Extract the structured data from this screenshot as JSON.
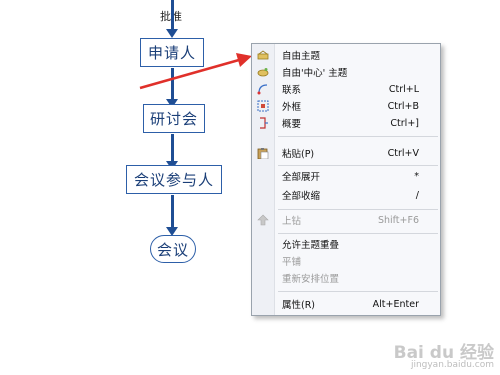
{
  "canvas": {
    "top_label": "批准",
    "nodes": {
      "n1": "申请人",
      "n2": "研讨会",
      "n3": "会议参与人",
      "n4": "会议"
    }
  },
  "colors": {
    "wire": "#1f4e94",
    "arrow": "#e0302a",
    "menu_bg": "#f7f8fb"
  },
  "menu": {
    "items": [
      {
        "label": "自由主题",
        "shortcut": "",
        "icon": "free-topic-icon"
      },
      {
        "label": "自由'中心' 主题",
        "shortcut": "",
        "icon": "free-central-topic-icon"
      },
      {
        "label": "联系",
        "shortcut": "Ctrl+L",
        "icon": "relationship-icon"
      },
      {
        "label": "外框",
        "shortcut": "Ctrl+B",
        "icon": "boundary-icon"
      },
      {
        "label": "概要",
        "shortcut": "Ctrl+]",
        "icon": "summary-icon"
      },
      {
        "label": "粘贴(P)",
        "shortcut": "Ctrl+V",
        "icon": "paste-icon"
      },
      {
        "label": "全部展开",
        "shortcut": "*",
        "icon": ""
      },
      {
        "label": "全部收缩",
        "shortcut": "/",
        "icon": ""
      },
      {
        "label": "上钻",
        "shortcut": "Shift+F6",
        "icon": "drill-up-icon"
      },
      {
        "label": "允许主题重叠",
        "shortcut": "",
        "icon": ""
      },
      {
        "label": "平铺",
        "shortcut": "",
        "icon": ""
      },
      {
        "label": "重新安排位置",
        "shortcut": "",
        "icon": ""
      },
      {
        "label": "属性(R)",
        "shortcut": "Alt+Enter",
        "icon": ""
      }
    ]
  },
  "watermark": {
    "brand": "Bai du 经验",
    "url": "jingyan.baidu.com"
  }
}
